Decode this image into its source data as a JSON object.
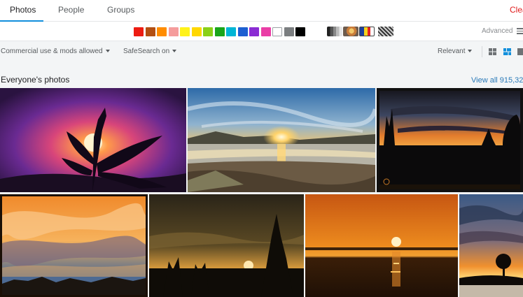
{
  "tabs": {
    "photos": "Photos",
    "people": "People",
    "groups": "Groups",
    "clear": "Clear"
  },
  "colors": {
    "swatches": [
      {
        "name": "red",
        "hex": "#ed1c12"
      },
      {
        "name": "dark-orange",
        "hex": "#b34f12"
      },
      {
        "name": "orange",
        "hex": "#ff8c00"
      },
      {
        "name": "pink",
        "hex": "#f59c9c"
      },
      {
        "name": "lemon-yellow",
        "hex": "#fff21a"
      },
      {
        "name": "school-bus-yellow",
        "hex": "#ffd700"
      },
      {
        "name": "green",
        "hex": "#8ad017"
      },
      {
        "name": "dark-lime-green",
        "hex": "#1aa51a"
      },
      {
        "name": "cyan",
        "hex": "#00b5d5"
      },
      {
        "name": "blue",
        "hex": "#1d5fd1"
      },
      {
        "name": "violet",
        "hex": "#8a2cd3"
      },
      {
        "name": "pink-magenta",
        "hex": "#ea3ea6"
      },
      {
        "name": "white",
        "hex": "#ffffff"
      },
      {
        "name": "gray",
        "hex": "#7b7e80"
      },
      {
        "name": "black",
        "hex": "#000000"
      }
    ],
    "styles": [
      "black-and-white-icon",
      "shallow-depth-of-field-icon",
      "minimalism-icon",
      "patterns-icon"
    ],
    "advanced_label": "Advanced"
  },
  "filters": {
    "license": "Commercial use & mods allowed",
    "safesearch": "SafeSearch on",
    "sort": "Relevant"
  },
  "section": {
    "title": "Everyone's photos",
    "view_all": "View all 915,32"
  }
}
